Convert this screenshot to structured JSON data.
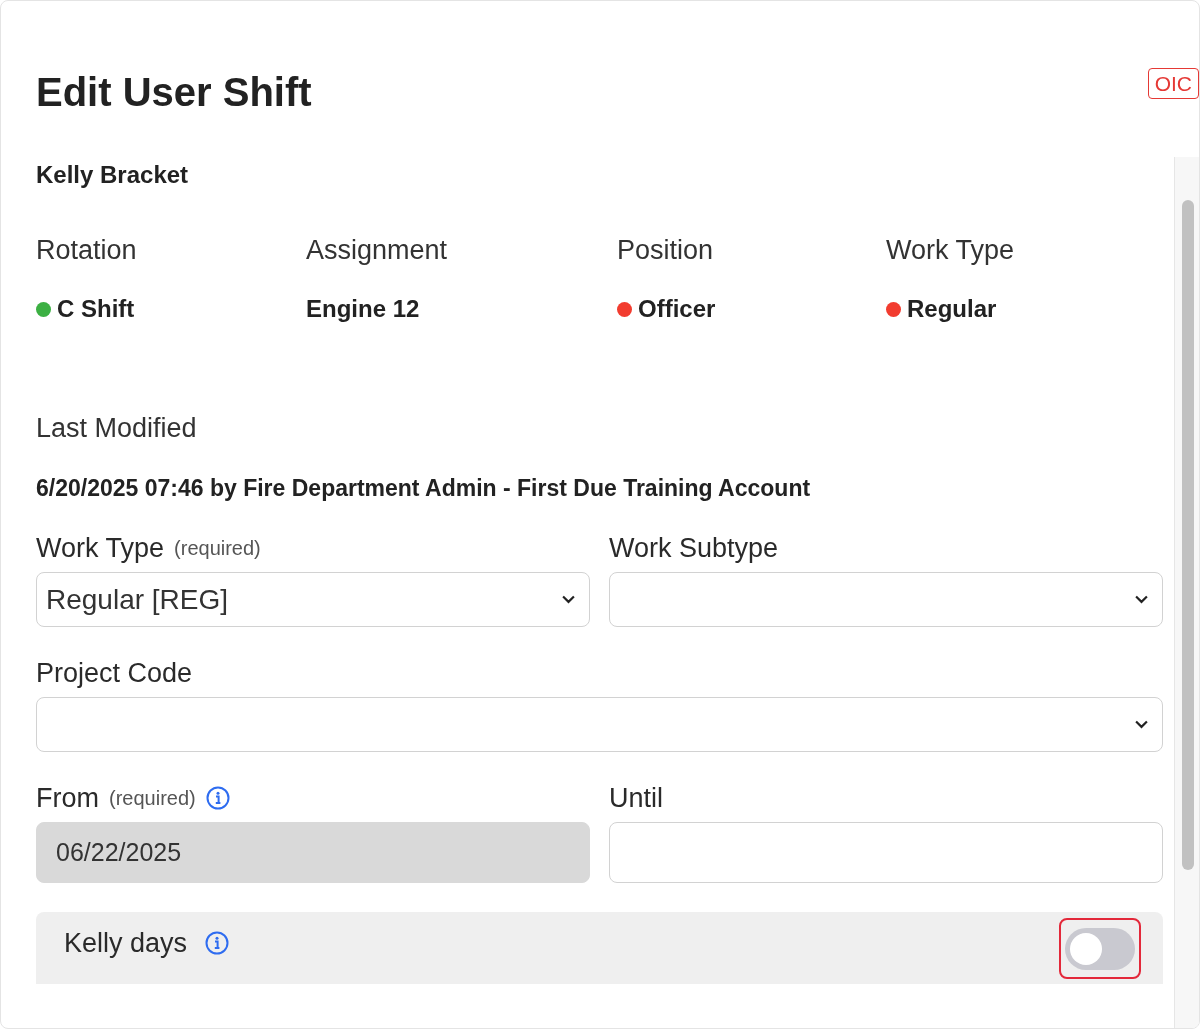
{
  "title": "Edit User Shift",
  "badge": "OIC",
  "user_name": "Kelly Bracket",
  "summary": [
    {
      "label": "Rotation",
      "value": "C Shift",
      "color": "#3cb043"
    },
    {
      "label": "Assignment",
      "value": "Engine 12"
    },
    {
      "label": "Position",
      "value": "Officer",
      "color": "#f23c2f"
    },
    {
      "label": "Work Type",
      "value": "Regular",
      "color": "#f23c2f"
    }
  ],
  "last_modified": {
    "label": "Last Modified",
    "value": "6/20/2025 07:46 by Fire Department Admin - First Due Training Account"
  },
  "form_rows": [
    [
      {
        "kind": "select",
        "label": "Work Type",
        "note": "(required)",
        "info": false,
        "disabled": false,
        "value": "Regular [REG]"
      },
      {
        "kind": "select",
        "label": "Work Subtype",
        "info": false,
        "disabled": false
      }
    ],
    [
      {
        "kind": "select",
        "label": "Project Code",
        "info": false,
        "disabled": false
      }
    ],
    [
      {
        "kind": "date",
        "label": "From",
        "note": "(required)",
        "info": true,
        "disabled": true,
        "value": "06/22/2025"
      },
      {
        "kind": "date",
        "label": "Until",
        "info": false,
        "disabled": false
      }
    ]
  ],
  "kelly_days": {
    "label": "Kelly days",
    "info": true,
    "on": false,
    "highlighted": true
  }
}
